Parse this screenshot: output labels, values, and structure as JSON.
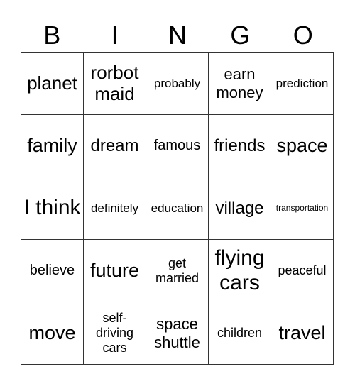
{
  "title_letters": [
    "B",
    "I",
    "N",
    "G",
    "O"
  ],
  "cells": [
    [
      "planet",
      "rorbot maid",
      "probably",
      "earn money",
      "prediction"
    ],
    [
      "family",
      "dream",
      "famous",
      "friends",
      "space"
    ],
    [
      "I think",
      "definitely",
      "education",
      "village",
      "transportation"
    ],
    [
      "believe",
      "future",
      "get married",
      "flying cars",
      "peaceful"
    ],
    [
      "move",
      "self-driving cars",
      "space shuttle",
      "children",
      "travel"
    ]
  ]
}
